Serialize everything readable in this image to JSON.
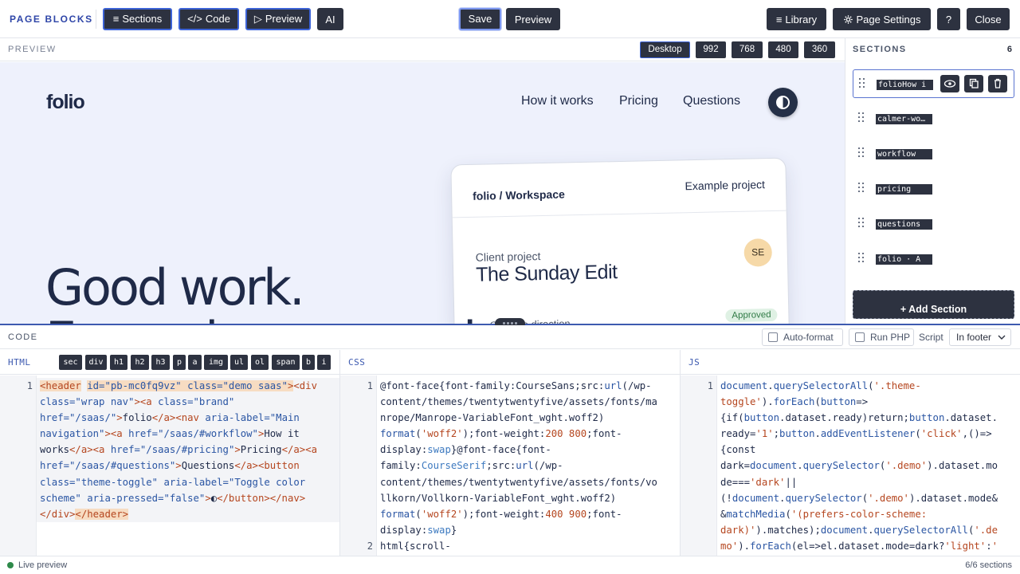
{
  "topbar": {
    "brand": "PAGE BLOCKS",
    "sections_label": "Sections",
    "code_label": "Code",
    "preview_label": "Preview",
    "ai_label": "AI",
    "save_label": "Save",
    "preview2_label": "Preview",
    "library_label": "Library",
    "page_settings_label": "Page Settings",
    "help_label": "?",
    "close_label": "Close"
  },
  "preview": {
    "label": "PREVIEW",
    "breakpoints": [
      "Desktop",
      "992",
      "768",
      "480",
      "360"
    ],
    "active_breakpoint": "Desktop"
  },
  "site": {
    "logo": "folio",
    "nav": [
      "How it works",
      "Pricing",
      "Questions"
    ],
    "hero_line1": "Good work.",
    "hero_line2": "Every day, everywhere.",
    "card": {
      "workspace": "folio / Workspace",
      "example": "Example project",
      "client_label": "Client project",
      "client_title": "The Sunday Edit",
      "avatar": "SE",
      "creative": "Creative direction",
      "status": "Approved"
    }
  },
  "sidebar": {
    "title": "SECTIONS",
    "count": "6",
    "items": [
      "folioHow i",
      "calmer-wo…",
      "workflow",
      "pricing",
      "questions",
      "folio · A"
    ],
    "add_label": "+ Add Section"
  },
  "codebar": {
    "label": "CODE",
    "auto_format": "Auto-format",
    "run_php": "Run PHP",
    "script_label": "Script",
    "script_option": "In footer"
  },
  "html_pane": {
    "name": "HTML",
    "tags": [
      "sec",
      "div",
      "h1",
      "h2",
      "h3",
      "p",
      "a",
      "img",
      "ul",
      "ol",
      "span",
      "b",
      "i"
    ],
    "line_numbers": [
      "1"
    ]
  },
  "css_pane": {
    "name": "CSS",
    "line_numbers": [
      "1",
      "2"
    ]
  },
  "js_pane": {
    "name": "JS",
    "line_numbers": [
      "1"
    ]
  },
  "status": {
    "live": "Live preview",
    "sections": "6/6 sections"
  },
  "colors": {
    "accent": "#3d5ab0",
    "dark_button": "#2d3240",
    "canvas_bg": "#eef1fc"
  }
}
